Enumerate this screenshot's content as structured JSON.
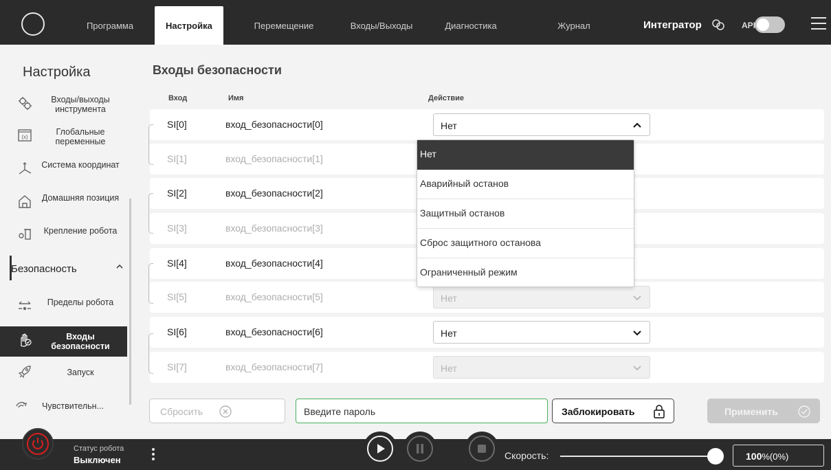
{
  "nav": {
    "tabs": [
      {
        "label": "Программа"
      },
      {
        "label": "Настройка"
      },
      {
        "label": "Перемещение"
      },
      {
        "label": "Входы/Выходы"
      },
      {
        "label": "Диагностика"
      },
      {
        "label": "Журнал"
      }
    ],
    "user": "Интегратор",
    "api_label": "API",
    "api_enabled": false
  },
  "sidebar": {
    "title": "Настройка",
    "items": [
      {
        "label": "Входы/выходы инструмента",
        "icon": "tool-io-icon"
      },
      {
        "label": "Глобальные переменные",
        "icon": "variable-icon"
      },
      {
        "label": "Система координат",
        "icon": "coordinate-axes-icon"
      },
      {
        "label": "Домашняя позиция",
        "icon": "home-icon"
      },
      {
        "label": "Крепление робота",
        "icon": "robot-mount-icon"
      }
    ],
    "section": "Безопасность",
    "sub_items": [
      {
        "label": "Пределы робота",
        "icon": "limits-icon"
      },
      {
        "label": "Входы безопасности",
        "icon": "safety-hand-icon"
      },
      {
        "label": "Запуск",
        "icon": "rocket-icon"
      },
      {
        "label": "Чувствительн...",
        "icon": "sensitivity-icon"
      }
    ]
  },
  "main": {
    "title": "Входы безопасности",
    "columns": {
      "input": "Вход",
      "name": "Имя",
      "action": "Действие"
    },
    "rows": [
      {
        "si": "SI[0]",
        "name": "вход_безопасности[0]",
        "action": "Нет"
      },
      {
        "si": "SI[1]",
        "name": "вход_безопасности[1]",
        "action": ""
      },
      {
        "si": "SI[2]",
        "name": "вход_безопасности[2]",
        "action": ""
      },
      {
        "si": "SI[3]",
        "name": "вход_безопасности[3]",
        "action": ""
      },
      {
        "si": "SI[4]",
        "name": "вход_безопасности[4]",
        "action": ""
      },
      {
        "si": "SI[5]",
        "name": "вход_безопасности[5]",
        "action": "Нет"
      },
      {
        "si": "SI[6]",
        "name": "вход_безопасности[6]",
        "action": "Нет"
      },
      {
        "si": "SI[7]",
        "name": "вход_безопасности[7]",
        "action": "Нет"
      }
    ],
    "dropdown_options": [
      "Нет",
      "Аварийный останов",
      "Защитный останов",
      "Сброс защитного останова",
      "Ограниченный режим"
    ]
  },
  "actions": {
    "reset": "Сбросить",
    "password_placeholder": "Введите пароль",
    "lock": "Заблокировать",
    "apply": "Применить"
  },
  "status": {
    "caption": "Статус робота",
    "value": "Выключен",
    "speed_label": "Скорость:",
    "speed_percent": "100",
    "speed_suffix": "%(0%)",
    "speed_level": 1.0
  },
  "colors": {
    "dark": "#2b2b2b",
    "power_red": "#d81f1f",
    "password_border": "#46b05a"
  }
}
